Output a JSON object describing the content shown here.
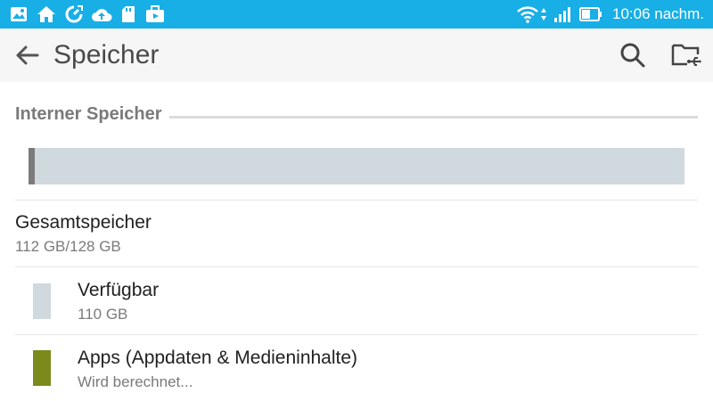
{
  "status_bar": {
    "time": "10:06 nachm.",
    "background": "#18aee6",
    "left_icons": [
      "gallery-icon",
      "home-icon",
      "clean-master-icon",
      "cloud-upload-icon",
      "sd-card-icon",
      "briefcase-icon"
    ],
    "right_icons": [
      "wifi-icon",
      "cell-signal-icon",
      "battery-icon"
    ]
  },
  "app_bar": {
    "title": "Speicher",
    "back_icon": "arrow-back-icon",
    "actions": [
      "search-icon",
      "usb-folder-icon"
    ]
  },
  "section": {
    "header": "Interner Speicher"
  },
  "storage_bar": {
    "used_fraction": 0.01,
    "used_color": "#7b7b7b",
    "free_color": "#d0d9de"
  },
  "total": {
    "title": "Gesamtspeicher",
    "value": "112 GB/128 GB"
  },
  "items": [
    {
      "title": "Verfügbar",
      "value": "110 GB",
      "color": "#d0d9de"
    },
    {
      "title": "Apps (Appdaten & Medieninhalte)",
      "value": "Wird berechnet...",
      "color": "#7c8a1c"
    }
  ]
}
